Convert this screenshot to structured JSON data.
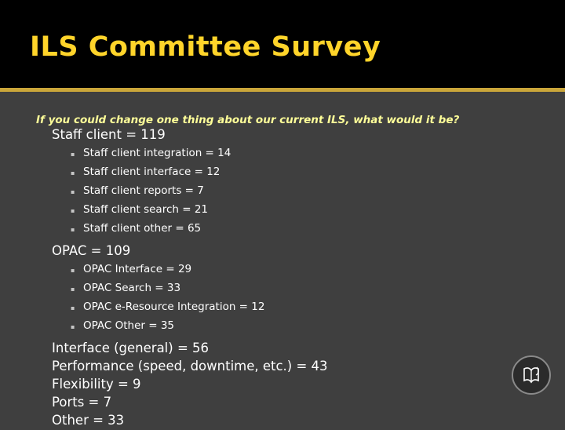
{
  "slide": {
    "title": "ILS Committee Survey",
    "question": "If you could change one thing about our current ILS, what would it be?",
    "colors": {
      "title_text": "#ffd42a",
      "title_band": "#000000",
      "body_background": "#3f3f3f",
      "rule": "#caa63a",
      "question_text": "#ffff99",
      "body_text": "#ffffff"
    },
    "items": [
      {
        "level": 1,
        "bullet": " ",
        "label": "Staff client = 119",
        "children": [
          {
            "level": 2,
            "bullet": "▪",
            "label": "Staff client integration = 14"
          },
          {
            "level": 2,
            "bullet": "▪",
            "label": "Staff client interface = 12"
          },
          {
            "level": 2,
            "bullet": "▪",
            "label": "Staff client reports = 7"
          },
          {
            "level": 2,
            "bullet": "▪",
            "label": "Staff client search = 21"
          },
          {
            "level": 2,
            "bullet": "▪",
            "label": "Staff client other = 65"
          }
        ]
      },
      {
        "level": 1,
        "bullet": " ",
        "label": "OPAC = 109",
        "children": [
          {
            "level": 2,
            "bullet": "▪",
            "label": "OPAC Interface = 29"
          },
          {
            "level": 2,
            "bullet": "▪",
            "label": "OPAC Search = 33"
          },
          {
            "level": 2,
            "bullet": "▪",
            "label": "OPAC e-Resource Integration = 12"
          },
          {
            "level": 2,
            "bullet": "▪",
            "label": "OPAC Other = 35"
          }
        ]
      },
      {
        "level": 1,
        "bullet": " ",
        "label": "Interface (general) = 56",
        "children": []
      },
      {
        "level": 1,
        "bullet": " ",
        "label": "Performance (speed, downtime, etc.) = 43",
        "children": []
      },
      {
        "level": 1,
        "bullet": " ",
        "label": "Flexibility = 9",
        "children": []
      },
      {
        "level": 1,
        "bullet": " ",
        "label": "Ports = 7",
        "children": []
      },
      {
        "level": 1,
        "bullet": " ",
        "label": "Other = 33",
        "children": []
      }
    ]
  }
}
